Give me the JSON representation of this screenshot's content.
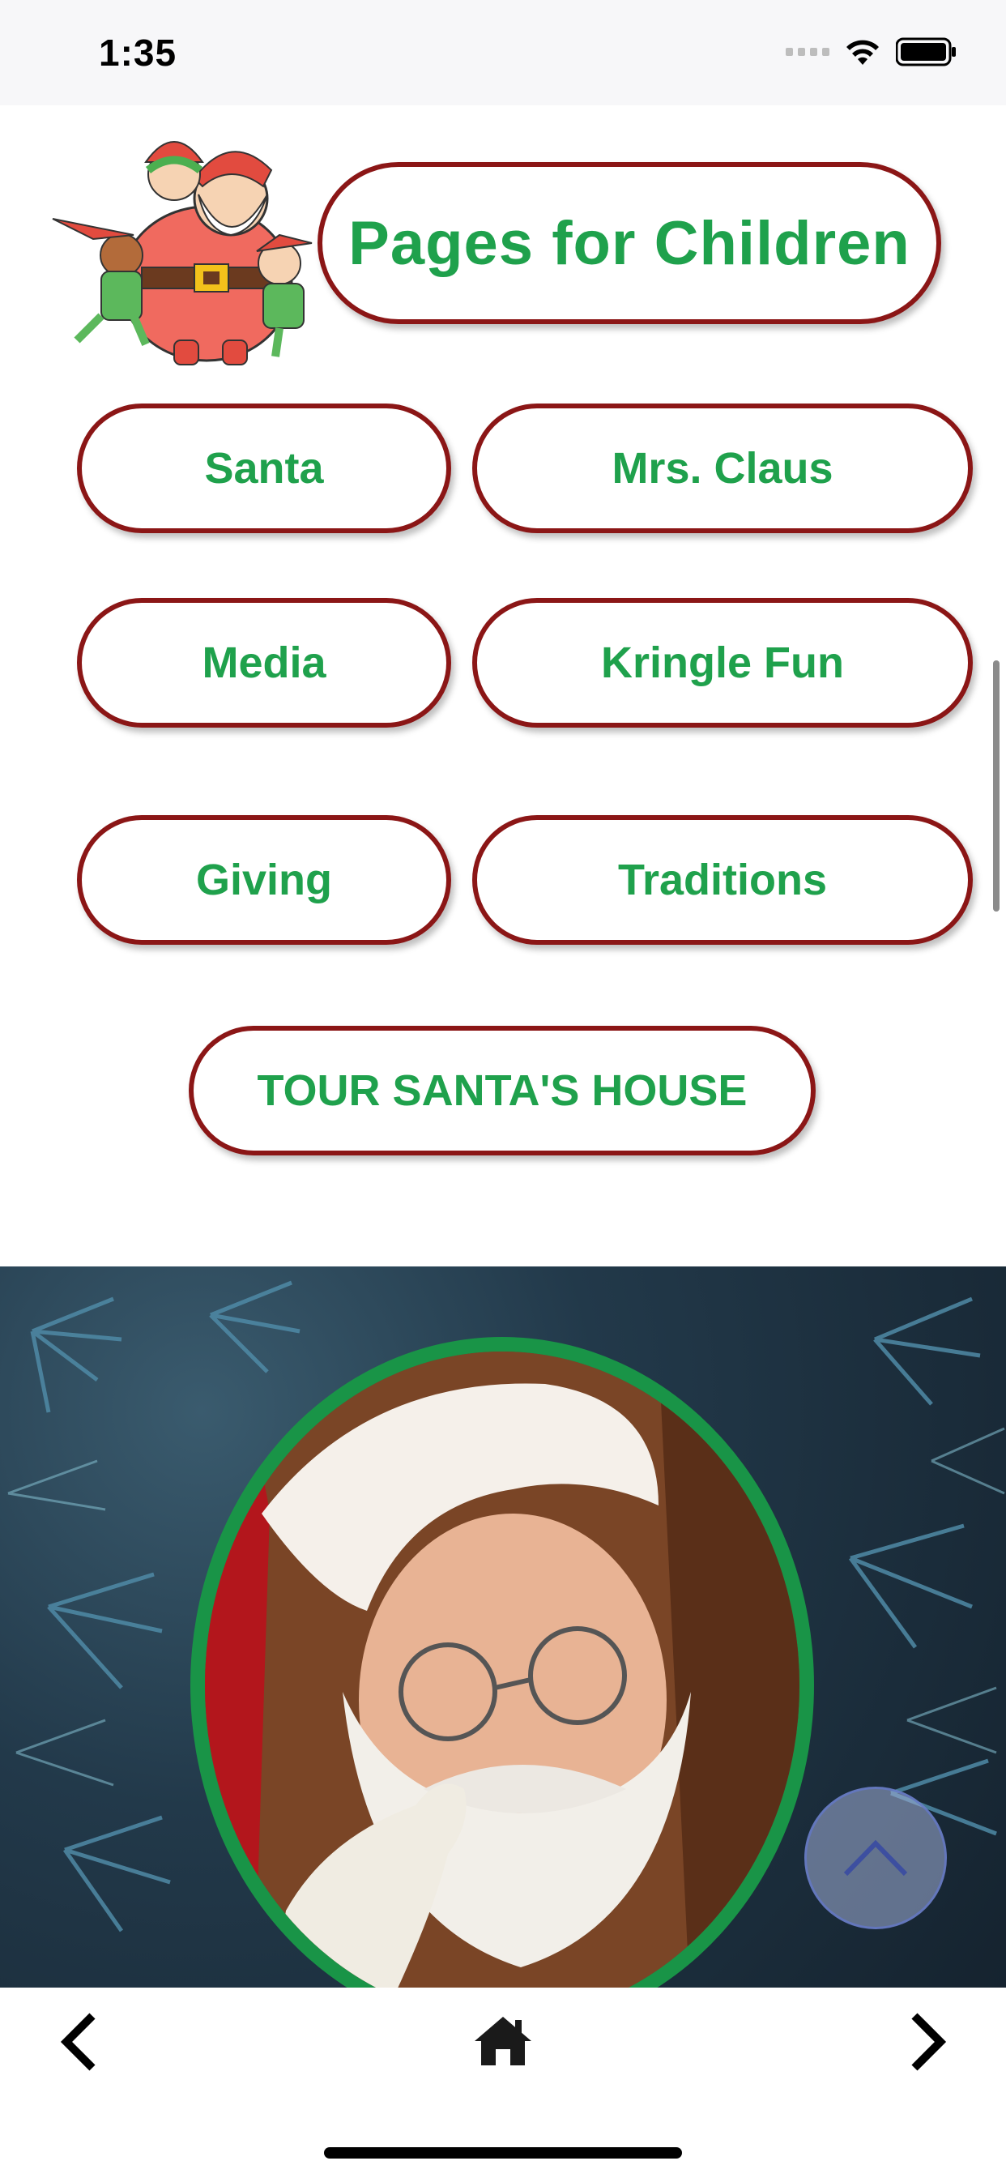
{
  "status_bar": {
    "time": "1:35"
  },
  "header": {
    "title": "Pages for Children"
  },
  "menu": {
    "santa": "Santa",
    "mrs_claus": "Mrs. Claus",
    "media": "Media",
    "kringle_fun": "Kringle Fun",
    "giving": "Giving",
    "traditions": "Traditions",
    "tour": "TOUR SANTA'S HOUSE"
  },
  "colors": {
    "accent_green": "#1fa14c",
    "border_red": "#8b1616",
    "frame_green": "#199447"
  },
  "icons": {
    "back": "chevron-left-icon",
    "home": "home-icon",
    "forward": "chevron-right-icon",
    "scroll_top": "chevron-up-icon"
  }
}
